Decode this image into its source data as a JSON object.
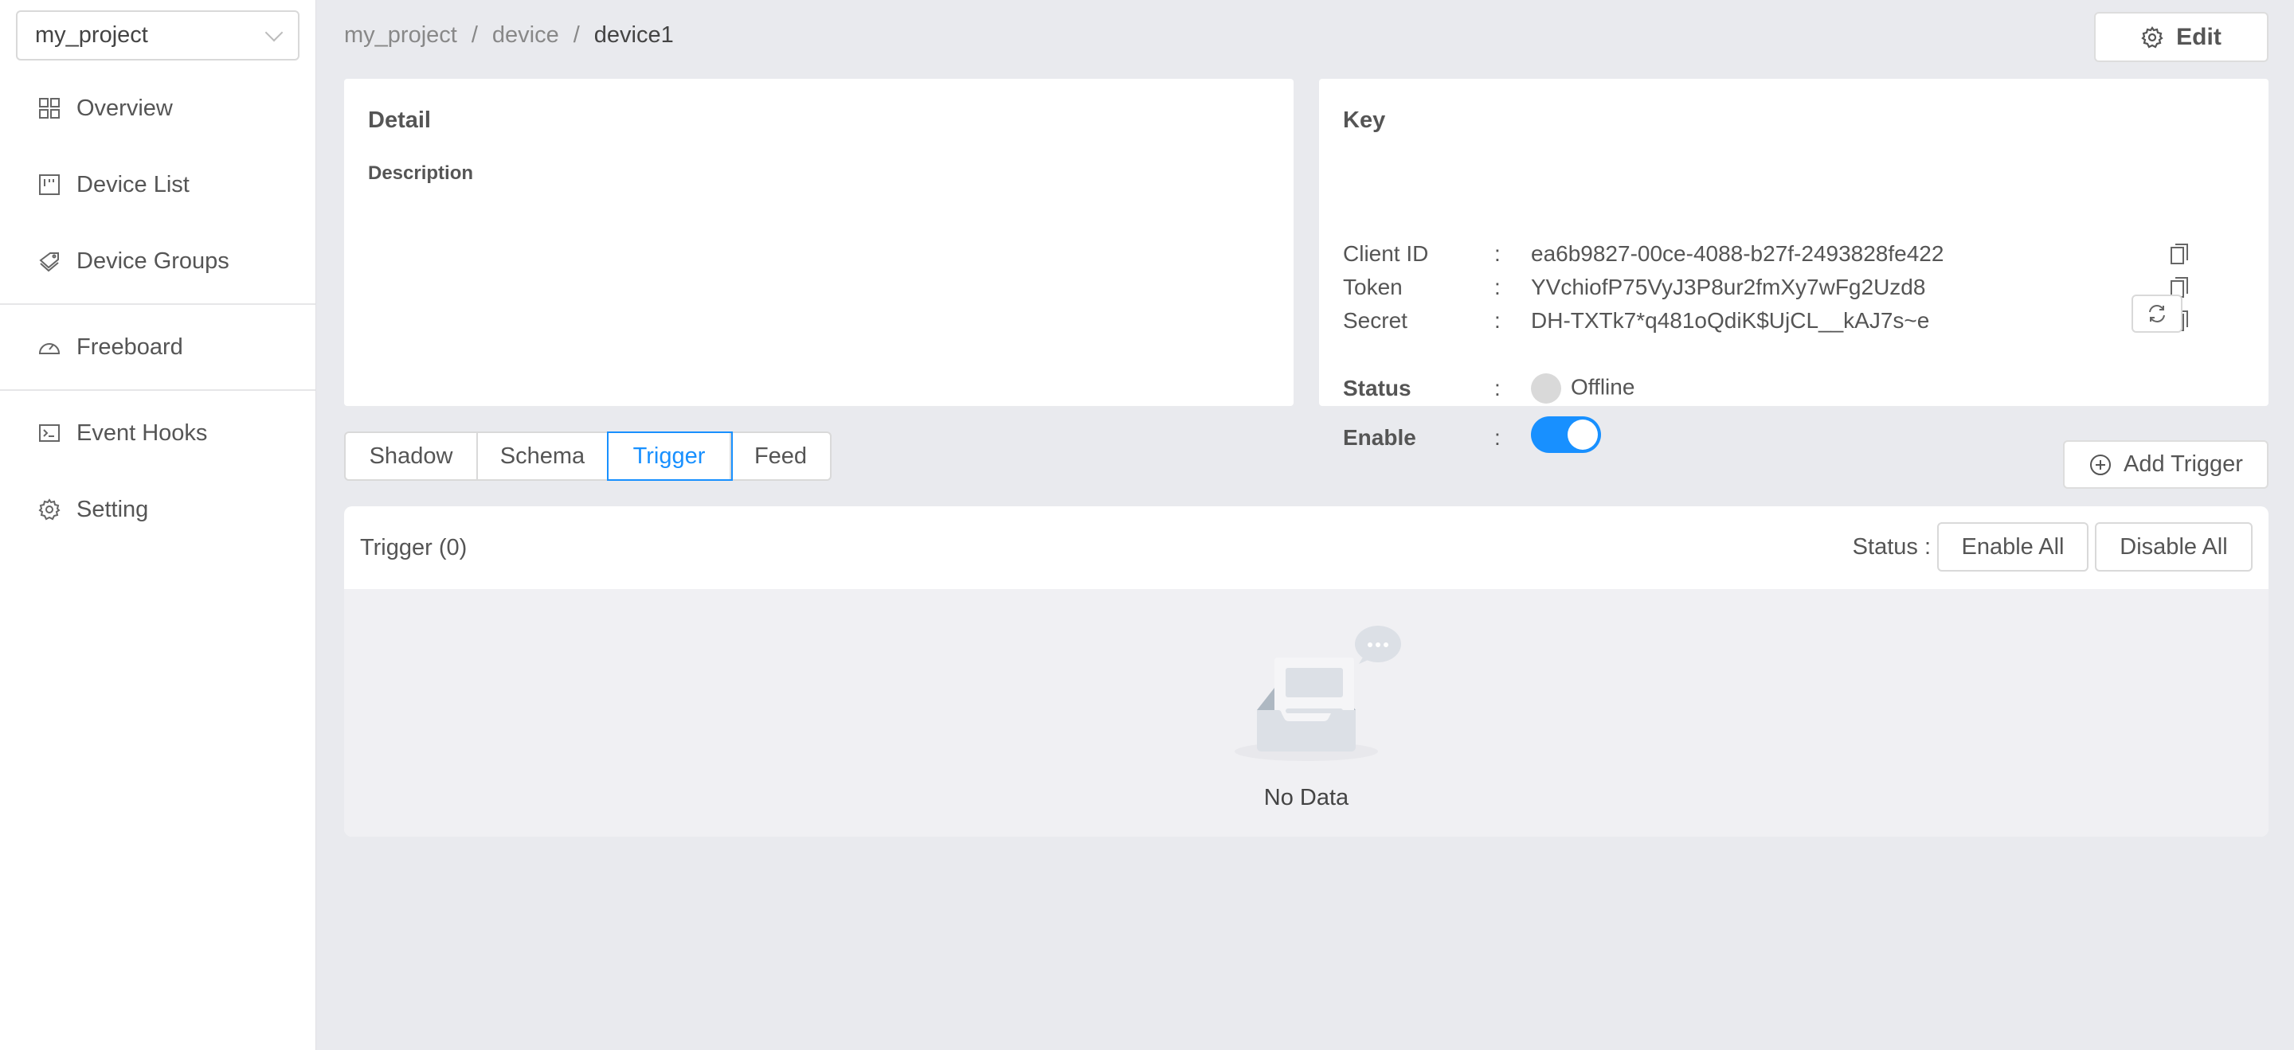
{
  "sidebar": {
    "project": "my_project",
    "items": [
      {
        "label": "Overview",
        "icon": "grid-icon"
      },
      {
        "label": "Device List",
        "icon": "board-icon"
      },
      {
        "label": "Device Groups",
        "icon": "tags-icon"
      },
      {
        "label": "Freeboard",
        "icon": "dashboard-icon"
      },
      {
        "label": "Event Hooks",
        "icon": "terminal-icon"
      },
      {
        "label": "Setting",
        "icon": "gear-icon"
      }
    ]
  },
  "breadcrumb": [
    "my_project",
    "device",
    "device1"
  ],
  "header": {
    "edit_label": "Edit"
  },
  "detail": {
    "title": "Detail",
    "description_label": "Description"
  },
  "key": {
    "title": "Key",
    "client_id_label": "Client ID",
    "client_id": "ea6b9827-00ce-4088-b27f-2493828fe422",
    "token_label": "Token",
    "token": "YVchiofP75VyJ3P8ur2fmXy7wFg2Uzd8",
    "secret_label": "Secret",
    "secret": "DH-TXTk7*q481oQdiK$UjCL__kAJ7s~e",
    "status_label": "Status",
    "status_value": "Offline",
    "enable_label": "Enable",
    "enabled": true,
    "colon": ":"
  },
  "tabs": [
    {
      "label": "Shadow",
      "active": false
    },
    {
      "label": "Schema",
      "active": false
    },
    {
      "label": "Trigger",
      "active": true
    },
    {
      "label": "Feed",
      "active": false
    }
  ],
  "trigger": {
    "add_label": "Add Trigger",
    "title": "Trigger (0)",
    "status_label": "Status :",
    "enable_all": "Enable All",
    "disable_all": "Disable All",
    "empty_text": "No Data"
  },
  "colors": {
    "accent": "#1890ff",
    "background": "#e9eaee",
    "offline": "#d9d9d9"
  }
}
